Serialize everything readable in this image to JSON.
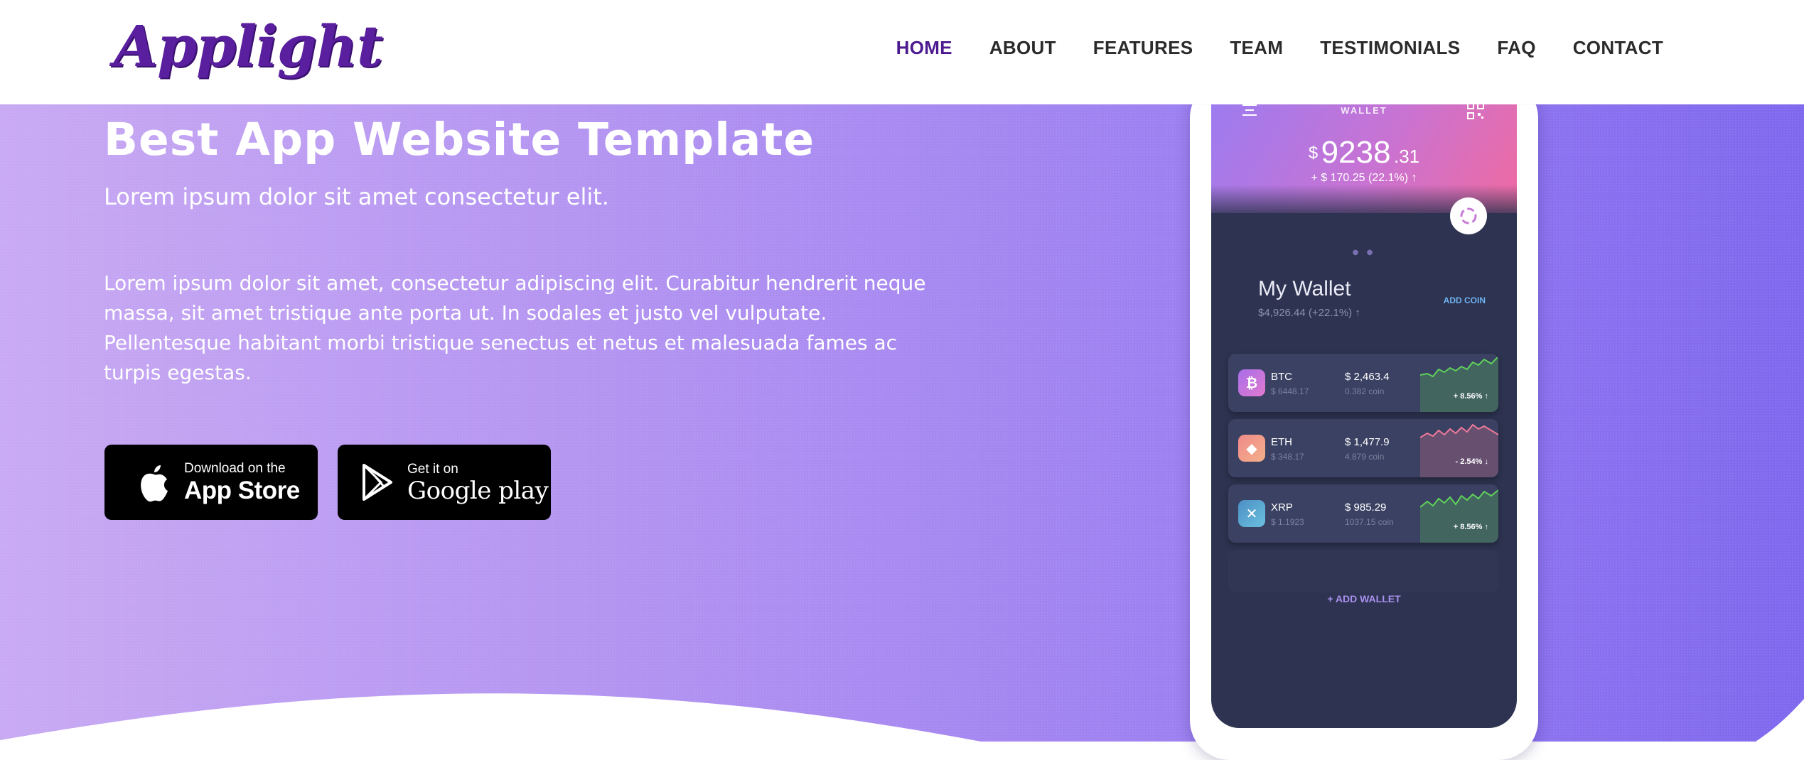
{
  "brand": {
    "logo_text": "Applight",
    "logo_color": "#5a1f9e"
  },
  "nav": {
    "items": [
      {
        "label": "HOME",
        "active": true
      },
      {
        "label": "ABOUT"
      },
      {
        "label": "FEATURES"
      },
      {
        "label": "TEAM"
      },
      {
        "label": "TESTIMONIALS"
      },
      {
        "label": "FAQ"
      },
      {
        "label": "CONTACT"
      }
    ],
    "active_color": "#4d1a90"
  },
  "hero": {
    "title": "Best App Website Template",
    "subtitle": "Lorem ipsum dolor sit amet consectetur elit.",
    "paragraph": "Lorem ipsum dolor sit amet, consectetur adipiscing elit. Curabitur hendrerit neque massa, sit amet tristique ante porta ut. In sodales et justo vel vulputate. Pellentesque habitant morbi tristique senectus et netus et malesuada fames ac turpis egestas.",
    "gradient": [
      "#c8a9f3",
      "#7f68ee"
    ],
    "buttons": {
      "app_store": {
        "small": "Download on the",
        "big": "App Store",
        "icon": "apple-icon"
      },
      "google_play": {
        "small": "Get it on",
        "big": "Google play",
        "icon": "play-icon"
      }
    }
  },
  "phone": {
    "wallet_label": "WALLET",
    "balance": {
      "currency": "$",
      "main": "9238",
      "cents": ".31"
    },
    "change": "+ $ 170.25 (22.1%) ↑",
    "my_wallet": "My Wallet",
    "my_wallet_sub": "$4,926.44 (+22.1%) ↑",
    "add_coin": "ADD COIN",
    "coins": [
      {
        "name": "BTC",
        "usd": "$ 6448.17",
        "price": "$ 2,463.4",
        "amount": "0.382 coin",
        "change": "+ 8.56% ↑",
        "icon_glyph": "₿",
        "icon_color": "#a86ee8",
        "trend_color": "#5fd35a"
      },
      {
        "name": "ETH",
        "usd": "$ 348.17",
        "price": "$ 1,477.9",
        "amount": "4.879 coin",
        "change": "- 2.54% ↓",
        "icon_glyph": "◆",
        "icon_color": "#f08a8a",
        "trend_color": "#f07a9a"
      },
      {
        "name": "XRP",
        "usd": "$ 1.1923",
        "price": "$ 985.29",
        "amount": "1037.15 coin",
        "change": "+ 8.56% ↑",
        "icon_glyph": "✕",
        "icon_color": "#5aa9d6",
        "trend_color": "#5fd35a"
      }
    ],
    "add_wallet": "+ ADD WALLET"
  }
}
